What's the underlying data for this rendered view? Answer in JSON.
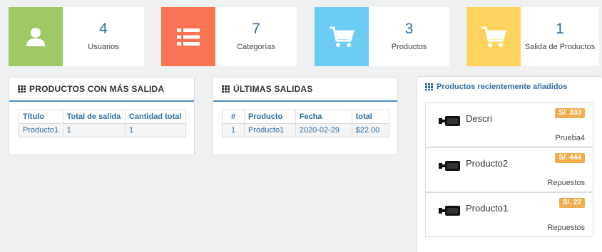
{
  "stats": [
    {
      "value": "4",
      "label": "Usuarios",
      "color": "#a0c864",
      "icon": "user-icon"
    },
    {
      "value": "7",
      "label": "Categorías",
      "color": "#f97452",
      "icon": "list-icon"
    },
    {
      "value": "3",
      "label": "Productos",
      "color": "#6ccbf2",
      "icon": "cart-icon"
    },
    {
      "value": "1",
      "label": "Salida de Productos",
      "color": "#fdd25e",
      "icon": "cart-icon"
    }
  ],
  "top_products": {
    "title": "PRODUCTOS CON MÁS SALIDA",
    "headers": [
      "Título",
      "Total de salida",
      "Cantidad total"
    ],
    "rows": [
      [
        "Producto1",
        "1",
        "1"
      ]
    ]
  },
  "last_sales": {
    "title": "ÚLTIMAS SALIDAS",
    "headers": [
      "#",
      "Producto",
      "Fecha",
      "total"
    ],
    "rows": [
      [
        "1",
        "Producto1",
        "2020-02-29",
        "$22.00"
      ]
    ]
  },
  "recent_products": {
    "title": "Productos recientemente añadidos",
    "items": [
      {
        "name": "Descri",
        "price": "S/. 333",
        "category": "Prueba4"
      },
      {
        "name": "Producto2",
        "price": "S/. 444",
        "category": "Repuestos"
      },
      {
        "name": "Producto1",
        "price": "S/. 22",
        "category": "Repuestos"
      }
    ]
  }
}
